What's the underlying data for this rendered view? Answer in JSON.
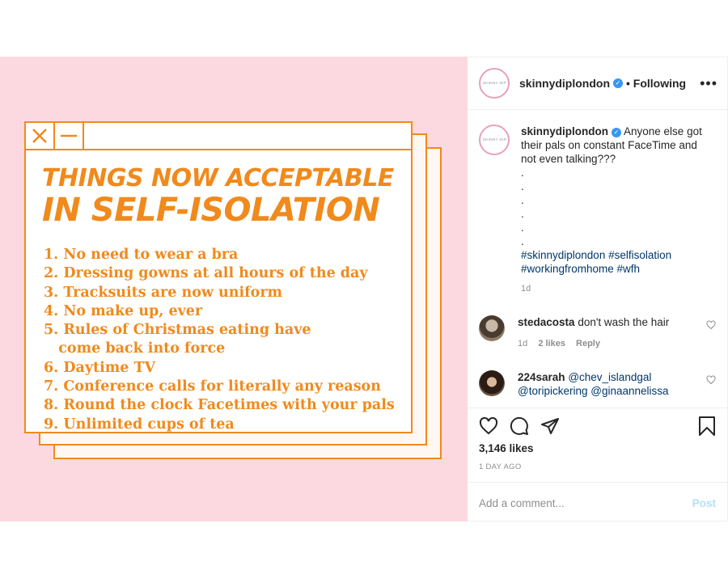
{
  "card": {
    "title_line1": "THINGS NOW ACCEPTABLE",
    "title_line2": "IN SELF-ISOLATION",
    "items": [
      "1. No need to wear a bra",
      "2. Dressing gowns at all hours of the day",
      "3. Tracksuits are now uniform",
      "4. No make up, ever",
      "5. Rules of Christmas eating have",
      "   come back into force",
      "6. Daytime TV",
      "7. Conference calls for literally any reason",
      "8. Round the clock Facetimes with your pals",
      "9. Unlimited cups of tea"
    ],
    "close_icon": "x-icon",
    "minimize_icon": "minus-icon"
  },
  "header": {
    "username": "skinnydiplondon",
    "avatar_text": "SKINNY DIP",
    "following": "• Following",
    "more": "•••"
  },
  "caption": {
    "username": "skinnydiplondon",
    "text": "Anyone else got their pals on constant FaceTime and not even talking???",
    "dots": [
      ".",
      ".",
      ".",
      ".",
      ".",
      "."
    ],
    "hashtags_line1": "#skinnydiplondon #selfisolation",
    "hashtags_line2": "#workingfromhome #wfh",
    "time": "1d"
  },
  "comments": [
    {
      "username": "stedacosta",
      "text": "don't wash the hair",
      "time": "1d",
      "likes": "2 likes",
      "reply": "Reply"
    },
    {
      "username": "224sarah",
      "mention1": "@chev_islandgal",
      "mention2": "@toripickering",
      "mention3": "@ginaannelissa"
    }
  ],
  "actions": {
    "likes": "3,146 likes",
    "ago": "1 DAY AGO"
  },
  "add_comment": {
    "placeholder": "Add a comment...",
    "post_label": "Post"
  },
  "colors": {
    "accent_orange": "#f08a1c",
    "pink_bg": "#fcd9e0",
    "link_blue": "#00376b",
    "verified_blue": "#3897f0"
  }
}
